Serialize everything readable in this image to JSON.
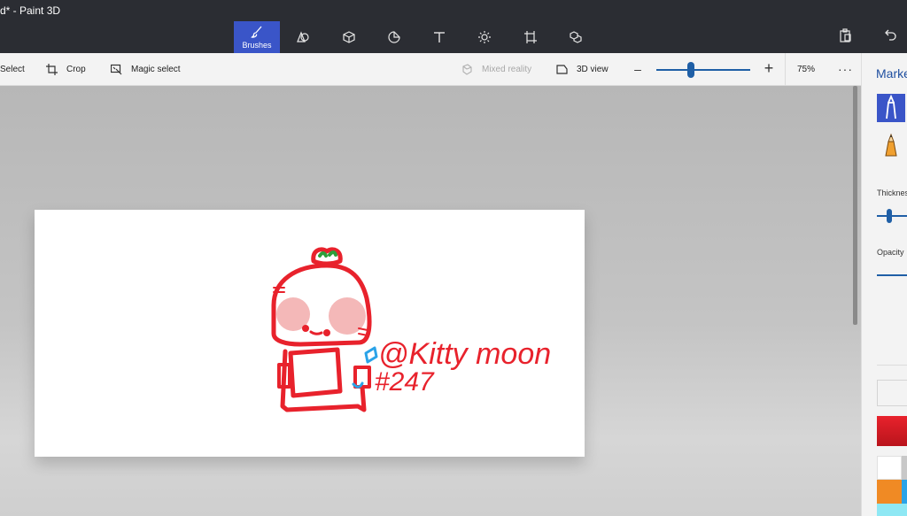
{
  "window": {
    "title": "d* - Paint 3D"
  },
  "toolbar": {
    "tools": [
      {
        "id": "brushes",
        "label": "Brushes",
        "icon": "brush-icon",
        "active": true
      },
      {
        "id": "2d-shapes",
        "label": "",
        "icon": "2d-shapes-icon",
        "active": false
      },
      {
        "id": "3d-shapes",
        "label": "",
        "icon": "3d-shapes-icon",
        "active": false
      },
      {
        "id": "stickers",
        "label": "",
        "icon": "stickers-icon",
        "active": false
      },
      {
        "id": "text",
        "label": "",
        "icon": "text-icon",
        "active": false
      },
      {
        "id": "effects",
        "label": "",
        "icon": "effects-icon",
        "active": false
      },
      {
        "id": "canvas",
        "label": "",
        "icon": "canvas-icon",
        "active": false
      },
      {
        "id": "3d-library",
        "label": "",
        "icon": "3d-library-icon",
        "active": false
      }
    ],
    "right_icons": [
      "paste-icon",
      "undo-icon"
    ]
  },
  "commandbar": {
    "select_label": "Select",
    "crop_label": "Crop",
    "magic_select_label": "Magic select",
    "mixed_reality_label": "Mixed reality",
    "view3d_label": "3D view",
    "zoom_value": "75%",
    "zoom_fraction": 0.37,
    "more_label": "···"
  },
  "panel": {
    "title": "Marker",
    "thickness_label": "Thickness",
    "opacity_label": "Opacity",
    "brushes": [
      "marker-icon",
      "pencil-icon"
    ]
  },
  "canvas_drawing": {
    "handle_text": "@Kitty moon",
    "number_text": "#247"
  },
  "colors": {
    "accent": "#3a55c8",
    "ink": "#e8222c",
    "swatches": [
      "#ffffff",
      "#c8c8c8",
      "#f08a24",
      "#2aa3e8",
      "#8fe8f4",
      "#e8222c"
    ]
  }
}
